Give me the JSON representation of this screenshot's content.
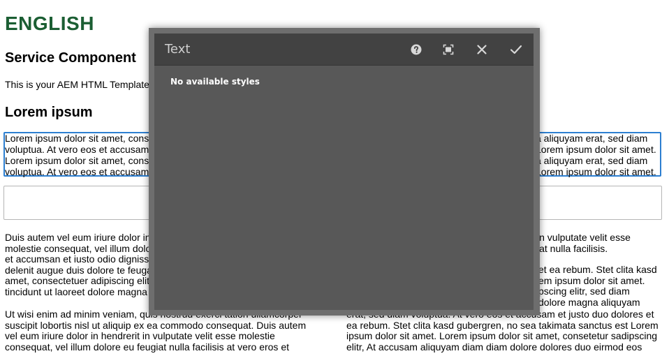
{
  "page": {
    "brand": "ENGLISH",
    "heading1": "Service Component",
    "intro": "This is your AEM HTML Template",
    "heading2": "Lorem ipsum",
    "selected_lines_left": [
      "Lorem ipsum dolor sit amet, conse",
      "voluptua. At vero eos et accusam",
      "Lorem ipsum dolor sit amet, conse",
      "voluptua. At vero eos et accusam"
    ],
    "selected_lines_right": [
      "a aliquyam erat, sed diam",
      "Lorem ipsum dolor sit amet.",
      "a aliquyam erat, sed diam",
      "Lorem ipsum dolor sit amet."
    ],
    "col_left_p1": [
      "Duis autem vel eum iriure dolor in",
      "molestie consequat, vel illum dolo",
      "et accumsan et iusto odio dignissi",
      "delenit augue duis dolore te feugai",
      "amet, consectetuer adipiscing elit,",
      "tincidunt ut laoreet dolore magna a"
    ],
    "col_left_p2": [
      "Ut wisi enim ad minim veniam, quis nostrud exerci tation ullamcorper",
      "suscipit lobortis nisl ut aliquip ex ea commodo consequat. Duis autem",
      "vel eum iriure dolor in hendrerit in vulputate velit esse molestie",
      "consequat, vel illum dolore eu feugiat nulla facilisis at vero eros et"
    ],
    "col_right_p1": [
      "in vulputate velit esse",
      "iat nulla facilisis."
    ],
    "col_right_p2": [
      "et ea rebum. Stet clita kasd",
      "em ipsum dolor sit amet.",
      "pscing elitr, sed diam",
      "dolore magna aliquyam"
    ],
    "col_right_p3": [
      "erat, sed diam voluptua. At vero eos et accusam et justo duo dolores et",
      "ea rebum. Stet clita kasd gubergren, no sea takimata sanctus est Lorem",
      "ipsum dolor sit amet. Lorem ipsum dolor sit amet, consetetur sadipscing",
      "elitr, At accusam aliquyam diam diam dolore dolores duo eirmod eos"
    ]
  },
  "dialog": {
    "title": "Text",
    "message": "No available styles",
    "icons": {
      "help": "help-icon",
      "fullscreen": "fullscreen-icon",
      "close": "close-icon",
      "confirm": "checkmark-icon"
    }
  },
  "colors": {
    "brand": "#1b5e33",
    "selection_border": "#2d7fd1",
    "dialog_body": "#585858",
    "dialog_header": "#424242"
  }
}
